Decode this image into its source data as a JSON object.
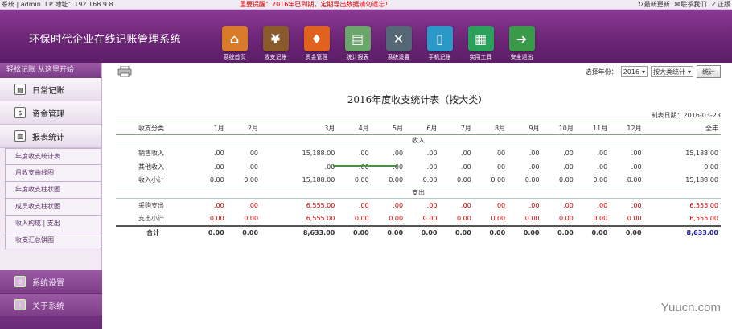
{
  "topbar": {
    "user": "系统 | admin",
    "ip_label": "I P 地址：",
    "ip": "192.168.9.8",
    "notice": "重要提醒：2016年已到期，定期导出数据请勿遗忘！",
    "links": [
      "最新更新",
      "联系我们",
      "正版"
    ]
  },
  "header": {
    "title": "环保时代企业在线记账管理系统"
  },
  "nav": [
    {
      "label": "系统首页",
      "icon": "home-icon",
      "glyph": "⌂",
      "color": "#d87a2a"
    },
    {
      "label": "收支记账",
      "icon": "ledger-icon",
      "glyph": "¥",
      "color": "#8a5a2a"
    },
    {
      "label": "资金管理",
      "icon": "piggybank-icon",
      "glyph": "♦",
      "color": "#e0621e"
    },
    {
      "label": "统计报表",
      "icon": "chart-icon",
      "glyph": "▤",
      "color": "#6aa56a"
    },
    {
      "label": "系统设置",
      "icon": "tools-icon",
      "glyph": "✕",
      "color": "#556677"
    },
    {
      "label": "手机记账",
      "icon": "phone-icon",
      "glyph": "▯",
      "color": "#2a98c8"
    },
    {
      "label": "实用工具",
      "icon": "calculator-icon",
      "glyph": "▦",
      "color": "#2aa05a"
    },
    {
      "label": "安全退出",
      "icon": "exit-icon",
      "glyph": "➜",
      "color": "#3a9a4a"
    }
  ],
  "sidebar": {
    "header": "轻松记账 从这里开始",
    "sections": [
      {
        "label": "日常记账",
        "icon": "notebook-icon"
      },
      {
        "label": "资金管理",
        "icon": "money-icon"
      },
      {
        "label": "报表统计",
        "icon": "report-icon"
      }
    ],
    "report_items": [
      "年度收支统计表",
      "月收支曲线图",
      "年度收支柱状图",
      "成员收支柱状图",
      "收入构成 | 支出",
      "收支汇总饼图"
    ],
    "lower_sections": [
      {
        "label": "系统设置",
        "icon": "settings-icon"
      },
      {
        "label": "关于系统",
        "icon": "info-icon"
      }
    ]
  },
  "toolbar": {
    "year_label": "选择年份：",
    "year_value": "2016",
    "mode_value": "按大类统计",
    "stat_button": "统计"
  },
  "report": {
    "title": "2016年度收支统计表（按大类）",
    "date": "制表日期：2016-03-23",
    "columns": [
      "收支分类",
      "1月",
      "2月",
      "3月",
      "4月",
      "5月",
      "6月",
      "7月",
      "8月",
      "9月",
      "10月",
      "11月",
      "12月",
      "全年"
    ],
    "income_group": "收入",
    "expense_group": "支出",
    "income_rows": [
      {
        "label": "销售收入",
        "cells": [
          ".00",
          ".00",
          "15,188.00",
          ".00",
          ".00",
          ".00",
          ".00",
          ".00",
          ".00",
          ".00",
          ".00",
          ".00",
          "15,188.00"
        ]
      },
      {
        "label": "其他收入",
        "cells": [
          ".00",
          ".00",
          ".00",
          ".00",
          ".00",
          ".00",
          ".00",
          ".00",
          ".00",
          ".00",
          ".00",
          ".00",
          "0.00"
        ]
      }
    ],
    "income_total": {
      "label": "收入小计",
      "cells": [
        "0.00",
        "0.00",
        "15,188.00",
        "0.00",
        "0.00",
        "0.00",
        "0.00",
        "0.00",
        "0.00",
        "0.00",
        "0.00",
        "0.00",
        "15,188.00"
      ]
    },
    "expense_rows": [
      {
        "label": "采购支出",
        "cells": [
          ".00",
          ".00",
          "6,555.00",
          ".00",
          ".00",
          ".00",
          ".00",
          ".00",
          ".00",
          ".00",
          ".00",
          ".00",
          "6,555.00"
        ]
      }
    ],
    "expense_total": {
      "label": "支出小计",
      "cells": [
        "0.00",
        "0.00",
        "6,555.00",
        "0.00",
        "0.00",
        "0.00",
        "0.00",
        "0.00",
        "0.00",
        "0.00",
        "0.00",
        "0.00",
        "6,555.00"
      ]
    },
    "grand_total": {
      "label": "合计",
      "cells": [
        "0.00",
        "0.00",
        "8,633.00",
        "0.00",
        "0.00",
        "0.00",
        "0.00",
        "0.00",
        "0.00",
        "0.00",
        "0.00",
        "0.00",
        "8,633.00"
      ]
    }
  },
  "watermark": "Yuucn.com"
}
